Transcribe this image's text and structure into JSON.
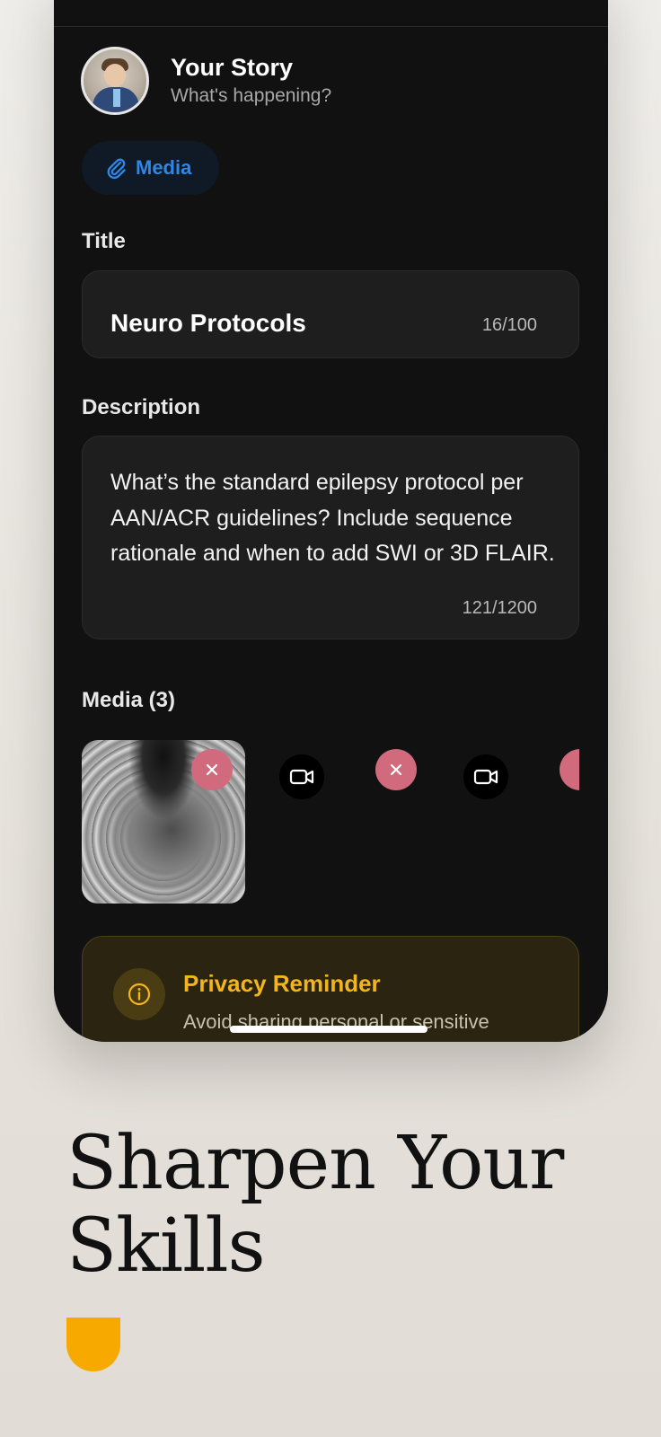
{
  "composer": {
    "header": {
      "title": "Your Story",
      "subtitle": "What's happening?"
    },
    "media_button": {
      "label": "Media",
      "icon": "paperclip-icon"
    },
    "title_field": {
      "label": "Title",
      "value": "Neuro Protocols",
      "counter": "16/100"
    },
    "description_field": {
      "label": "Description",
      "value": "What’s the standard epilepsy protocol per AAN/ACR guidelines? Include sequence rationale and when to add SWI or 3D FLAIR.",
      "counter": "121/1200"
    },
    "media_section": {
      "label": "Media (3)",
      "items": [
        {
          "type": "image",
          "icon": "close-icon"
        },
        {
          "type": "video",
          "icon": "video-camera-icon"
        },
        {
          "type": "video",
          "icon": "video-camera-icon"
        }
      ]
    },
    "privacy": {
      "title": "Privacy Reminder",
      "text": "Avoid sharing personal or sensitive",
      "icon": "info-icon"
    }
  },
  "marketing": {
    "headline_line1": "Sharpen Your",
    "headline_line2": "Skills"
  },
  "colors": {
    "accent_blue": "#2f86e4",
    "remove_pink": "#d06a7c",
    "privacy_yellow": "#f3b51e",
    "brand_orange": "#f7a900",
    "phone_bg": "#111111"
  }
}
